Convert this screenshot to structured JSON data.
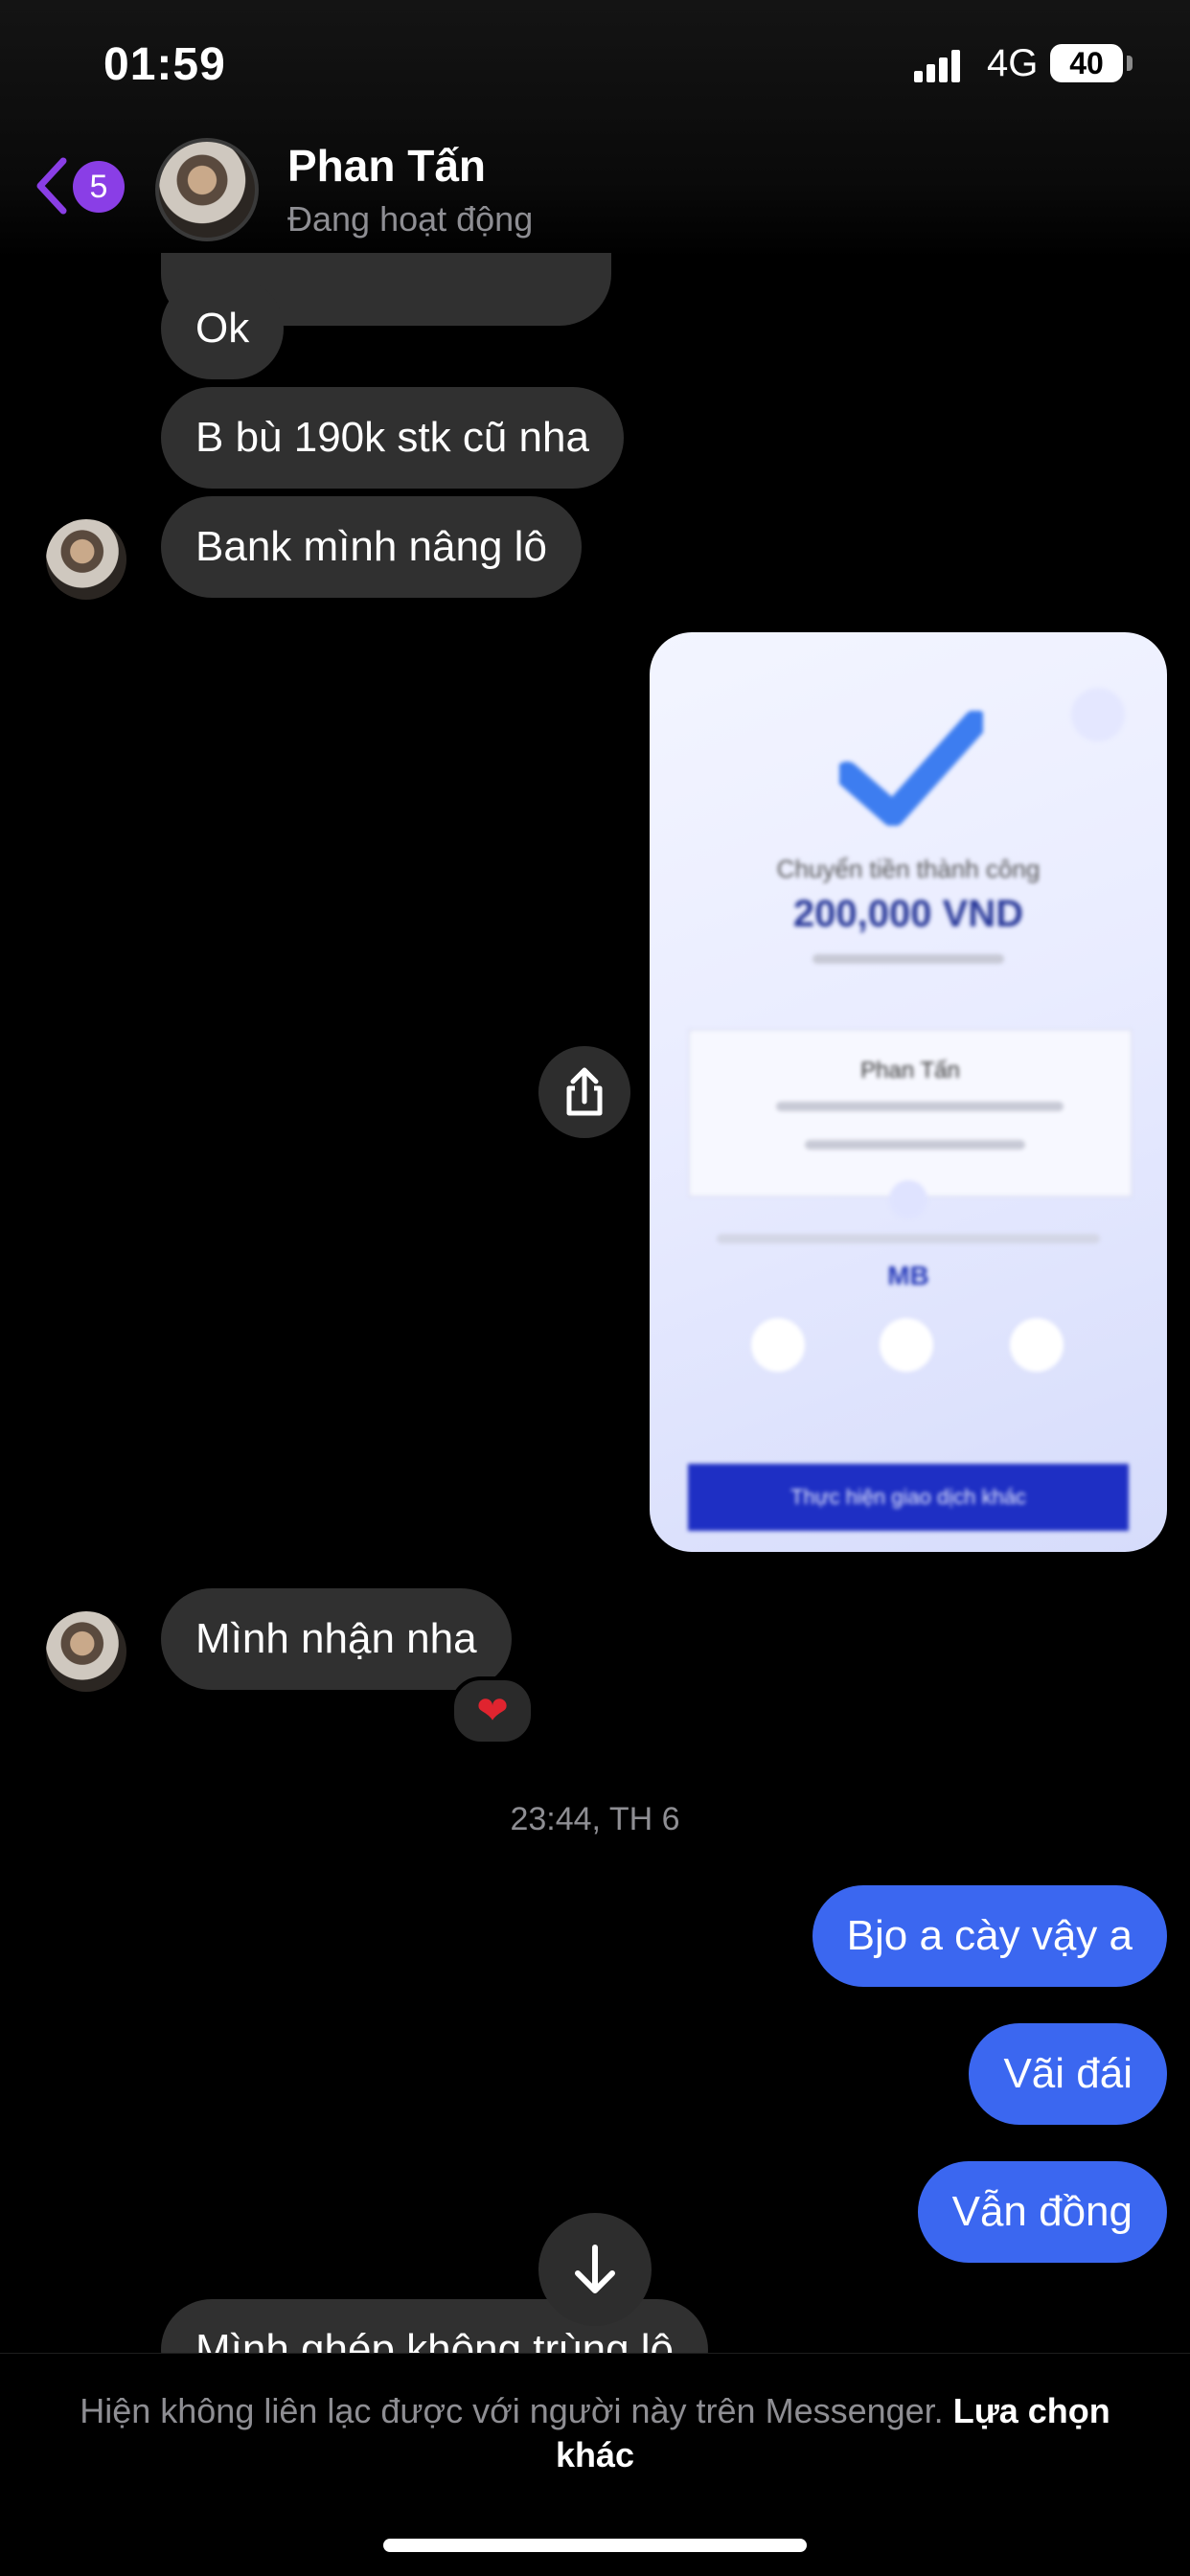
{
  "status_bar": {
    "time": "01:59",
    "network": "4G",
    "battery": "40"
  },
  "header": {
    "back_badge": "5",
    "name": "Phan Tấn",
    "presence": "Đang hoạt động"
  },
  "messages": {
    "ok": "Ok",
    "b_bu": "B bù 190k stk cũ nha",
    "bank": "Bank mình nâng lô",
    "minh_nhan": "Mình nhận nha",
    "reaction": "❤",
    "timestamp": "23:44, TH 6",
    "bjo": "Bjo a cày vậy a",
    "vai_dai": "Vãi đái",
    "van_dong": "Vẫn đồng",
    "partial": "Mình ghép không trùng lô"
  },
  "receipt": {
    "title": "Chuyển tiền thành công",
    "amount": "200,000 VND",
    "recipient": "Phan Tấn",
    "bank_logo": "MB",
    "button": "Thực hiện giao dịch khác"
  },
  "footer": {
    "notice": "Hiện không liên lạc được với người này trên Messenger.",
    "link": "Lựa chọn khác"
  },
  "colors": {
    "my_bubble": "#3b67f0",
    "their_bubble": "#303030",
    "accent": "#8a3ee6"
  }
}
